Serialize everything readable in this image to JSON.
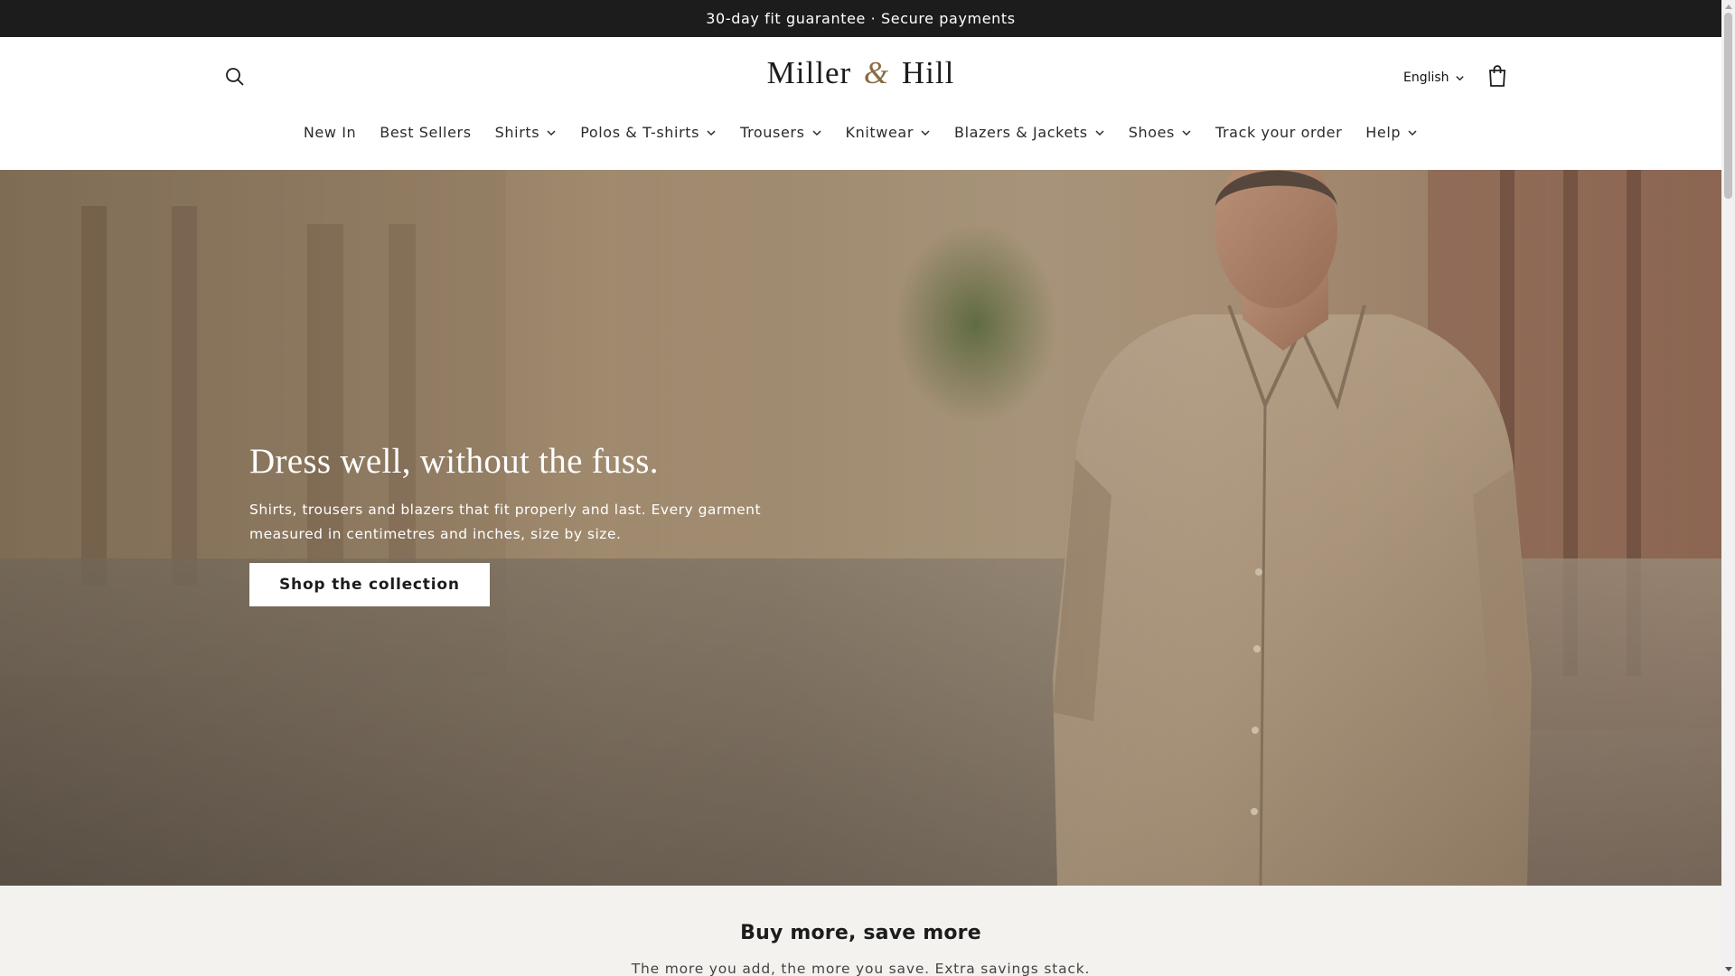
{
  "announcement": {
    "text": "30-day fit guarantee · Secure payments"
  },
  "header": {
    "logo": {
      "part1": "Miller",
      "amp": "&",
      "part2": "Hill"
    },
    "language": "English",
    "icons": {
      "search": "search-icon",
      "cart": "shopping-bag-icon"
    }
  },
  "nav": {
    "items": [
      {
        "label": "New In",
        "has_dropdown": false
      },
      {
        "label": "Best Sellers",
        "has_dropdown": false
      },
      {
        "label": "Shirts",
        "has_dropdown": true
      },
      {
        "label": "Polos & T-shirts",
        "has_dropdown": true
      },
      {
        "label": "Trousers",
        "has_dropdown": true
      },
      {
        "label": "Knitwear",
        "has_dropdown": true
      },
      {
        "label": "Blazers & Jackets",
        "has_dropdown": true
      },
      {
        "label": "Shoes",
        "has_dropdown": true
      },
      {
        "label": "Track your order",
        "has_dropdown": false
      },
      {
        "label": "Help",
        "has_dropdown": true
      }
    ]
  },
  "hero": {
    "title": "Dress well, without the fuss.",
    "text": "Shirts, trousers and blazers that fit properly and last. Every garment measured in centimetres and inches, size by size.",
    "button": "Shop the collection"
  },
  "savings": {
    "title": "Buy more, save more",
    "subtitle": "The more you add, the more you save. Extra savings stack."
  },
  "colors": {
    "announcement_bg": "#1c1c1c",
    "accent_amp": "#8a6a44",
    "section_bg": "#f3f2ef"
  }
}
